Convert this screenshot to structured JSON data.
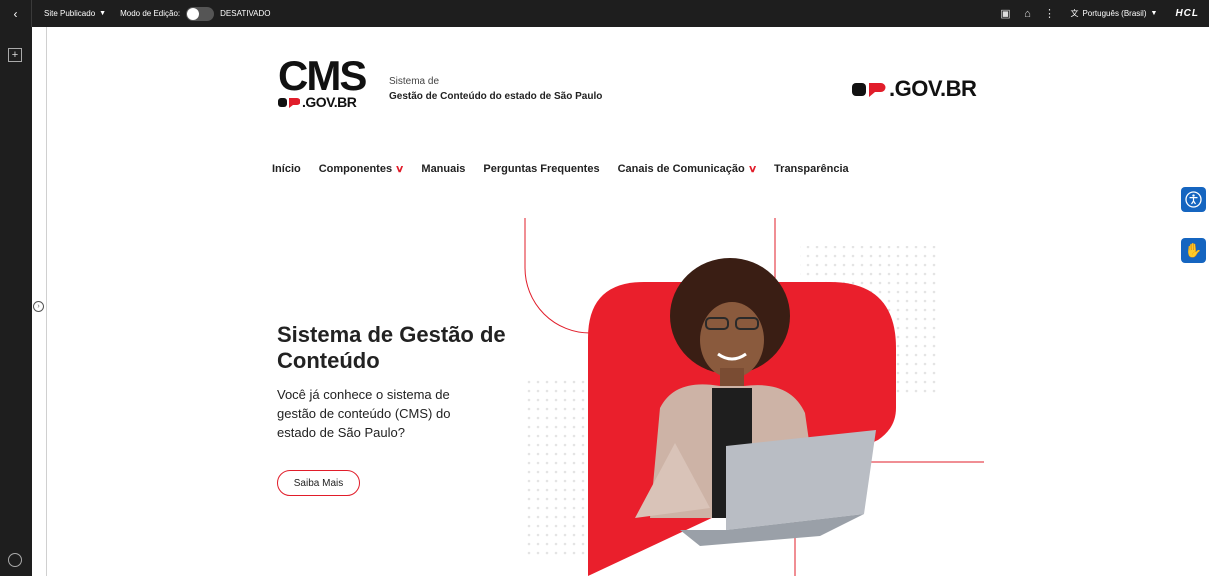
{
  "topbar": {
    "back_icon": "chevron-left-icon",
    "site_label": "Site Publicado",
    "mode_label": "Modo de Edição:",
    "mode_state": "DESATIVADO",
    "language": "Português (Brasil)",
    "brand": "HCL"
  },
  "header": {
    "logo_big": "CMS",
    "logo_sub": ".GOV.BR",
    "tagline_line1": "Sistema de",
    "tagline_line2": "Gestão de Conteúdo do estado de São Paulo",
    "right_logo": ".GOV.BR"
  },
  "nav": {
    "items": [
      {
        "label": "Início"
      },
      {
        "label": "Componentes"
      },
      {
        "label": "Manuais"
      },
      {
        "label": "Perguntas Frequentes"
      },
      {
        "label": "Canais de Comunicação"
      },
      {
        "label": "Transparência"
      }
    ]
  },
  "hero": {
    "title": "Sistema de Gestão de Conteúdo",
    "text": "Você já conhece o sistema de gestão de conteúdo (CMS) do estado de São Paulo?",
    "button": "Saiba Mais"
  },
  "colors": {
    "accent": "#e11d2a",
    "topbar": "#1e1e1e",
    "accessibility": "#1565c0"
  }
}
